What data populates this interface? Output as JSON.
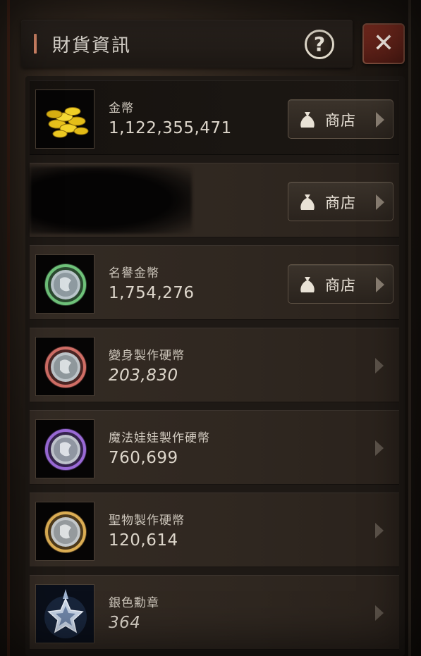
{
  "window": {
    "title": "財貨資訊",
    "help_symbol": "?",
    "close_symbol": "✕"
  },
  "currencies": [
    {
      "name": "金幣",
      "value": "1,122,355,471",
      "icon": "gold-coins-icon",
      "has_shop": true,
      "shop_label": "商店"
    },
    {
      "name": "",
      "value": "",
      "icon": "redacted-icon",
      "has_shop": true,
      "shop_label": "商店",
      "redacted": true
    },
    {
      "name": "名譽金幣",
      "value": "1,754,276",
      "icon": "honor-coin-icon",
      "has_shop": true,
      "shop_label": "商店",
      "ring_color": "#5fa868"
    },
    {
      "name": "變身製作硬幣",
      "value": "203,830",
      "icon": "transform-coin-icon",
      "has_shop": false,
      "ring_color": "#c0605a"
    },
    {
      "name": "魔法娃娃製作硬幣",
      "value": "760,699",
      "icon": "doll-coin-icon",
      "has_shop": false,
      "ring_color": "#8b5cc8"
    },
    {
      "name": "聖物製作硬幣",
      "value": "120,614",
      "icon": "relic-coin-icon",
      "has_shop": false,
      "ring_color": "#d2a24a"
    },
    {
      "name": "銀色勳章",
      "value": "364",
      "icon": "silver-medal-icon",
      "has_shop": false
    }
  ]
}
